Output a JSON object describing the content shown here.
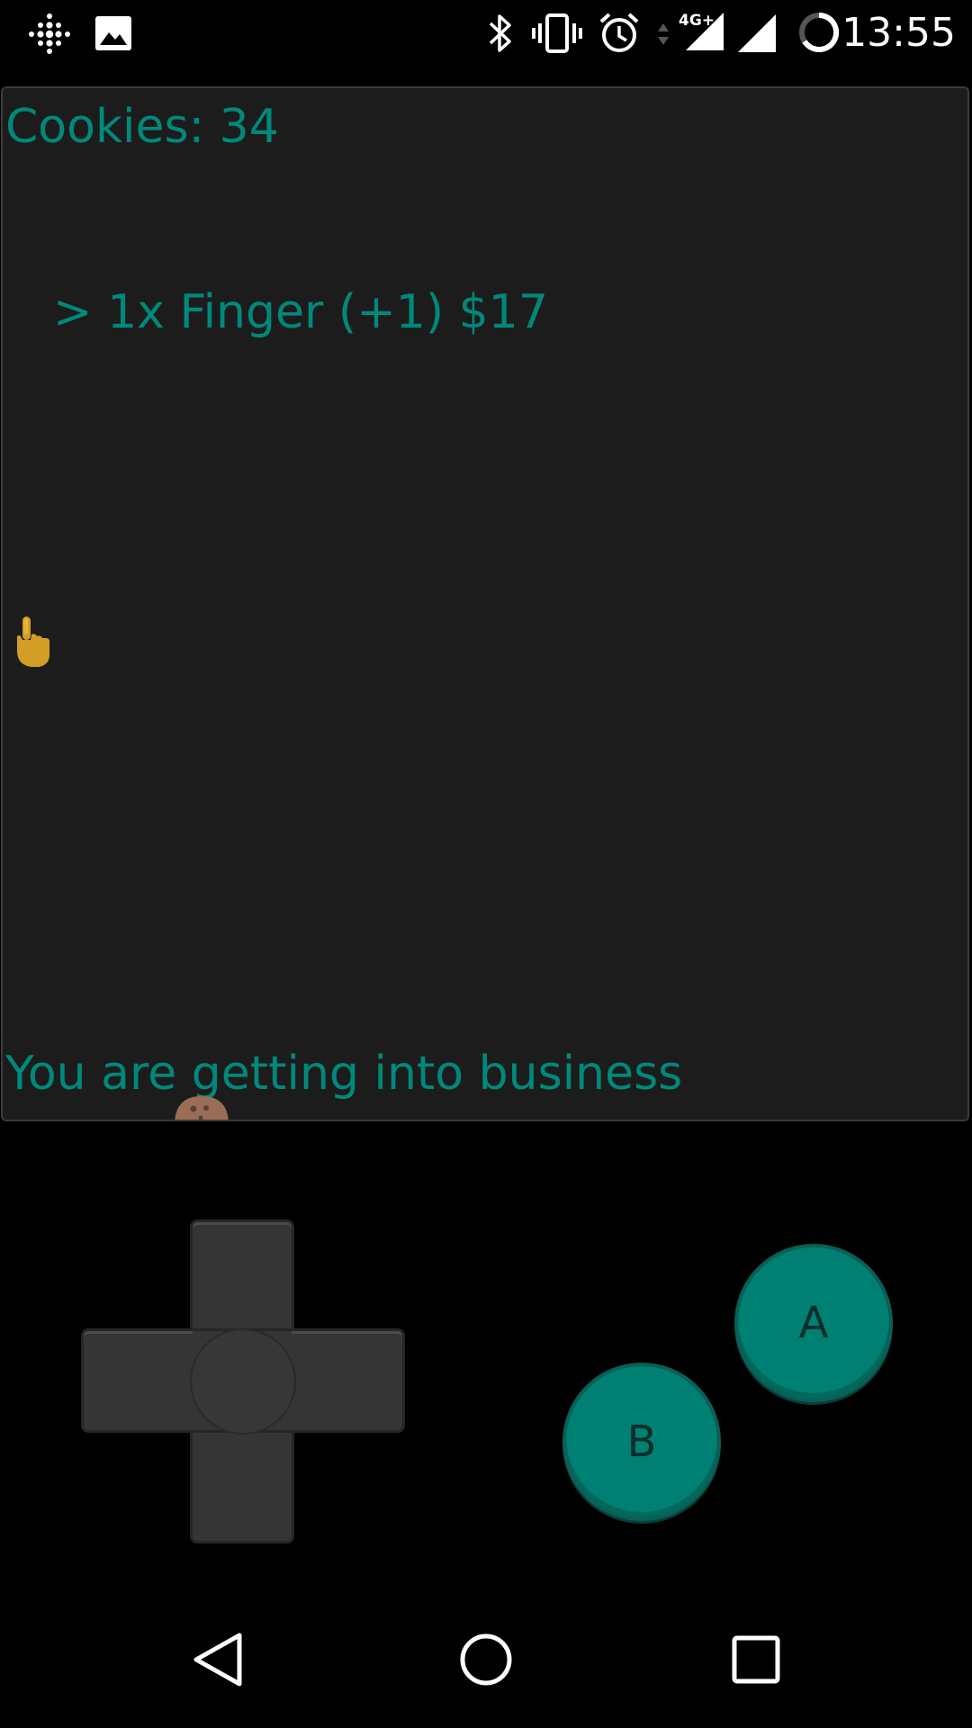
{
  "status_bar": {
    "time": "13:55",
    "left_icons": [
      "fitbit-icon",
      "image-icon"
    ],
    "right_icons": [
      "bluetooth-icon",
      "vibrate-icon",
      "alarm-icon",
      "data-arrows-icon",
      "signal-4g-icon",
      "signal-icon",
      "battery-icon"
    ],
    "network_label": "4G+"
  },
  "game": {
    "cookies_label": "Cookies: 34",
    "shop_item": "> 1x Finger (+1) $17",
    "message": "You are getting into business",
    "text_color": "#00897b",
    "screen_background": "#1c1c1c",
    "sprites": [
      "finger-pointer-icon",
      "cookie-icon"
    ]
  },
  "controls": {
    "dpad_directions": [
      "up",
      "down",
      "left",
      "right"
    ],
    "button_a_label": "A",
    "button_b_label": "B",
    "button_color": "#008072"
  },
  "nav_bar": {
    "buttons": [
      "back-icon",
      "home-icon",
      "recents-icon"
    ]
  }
}
